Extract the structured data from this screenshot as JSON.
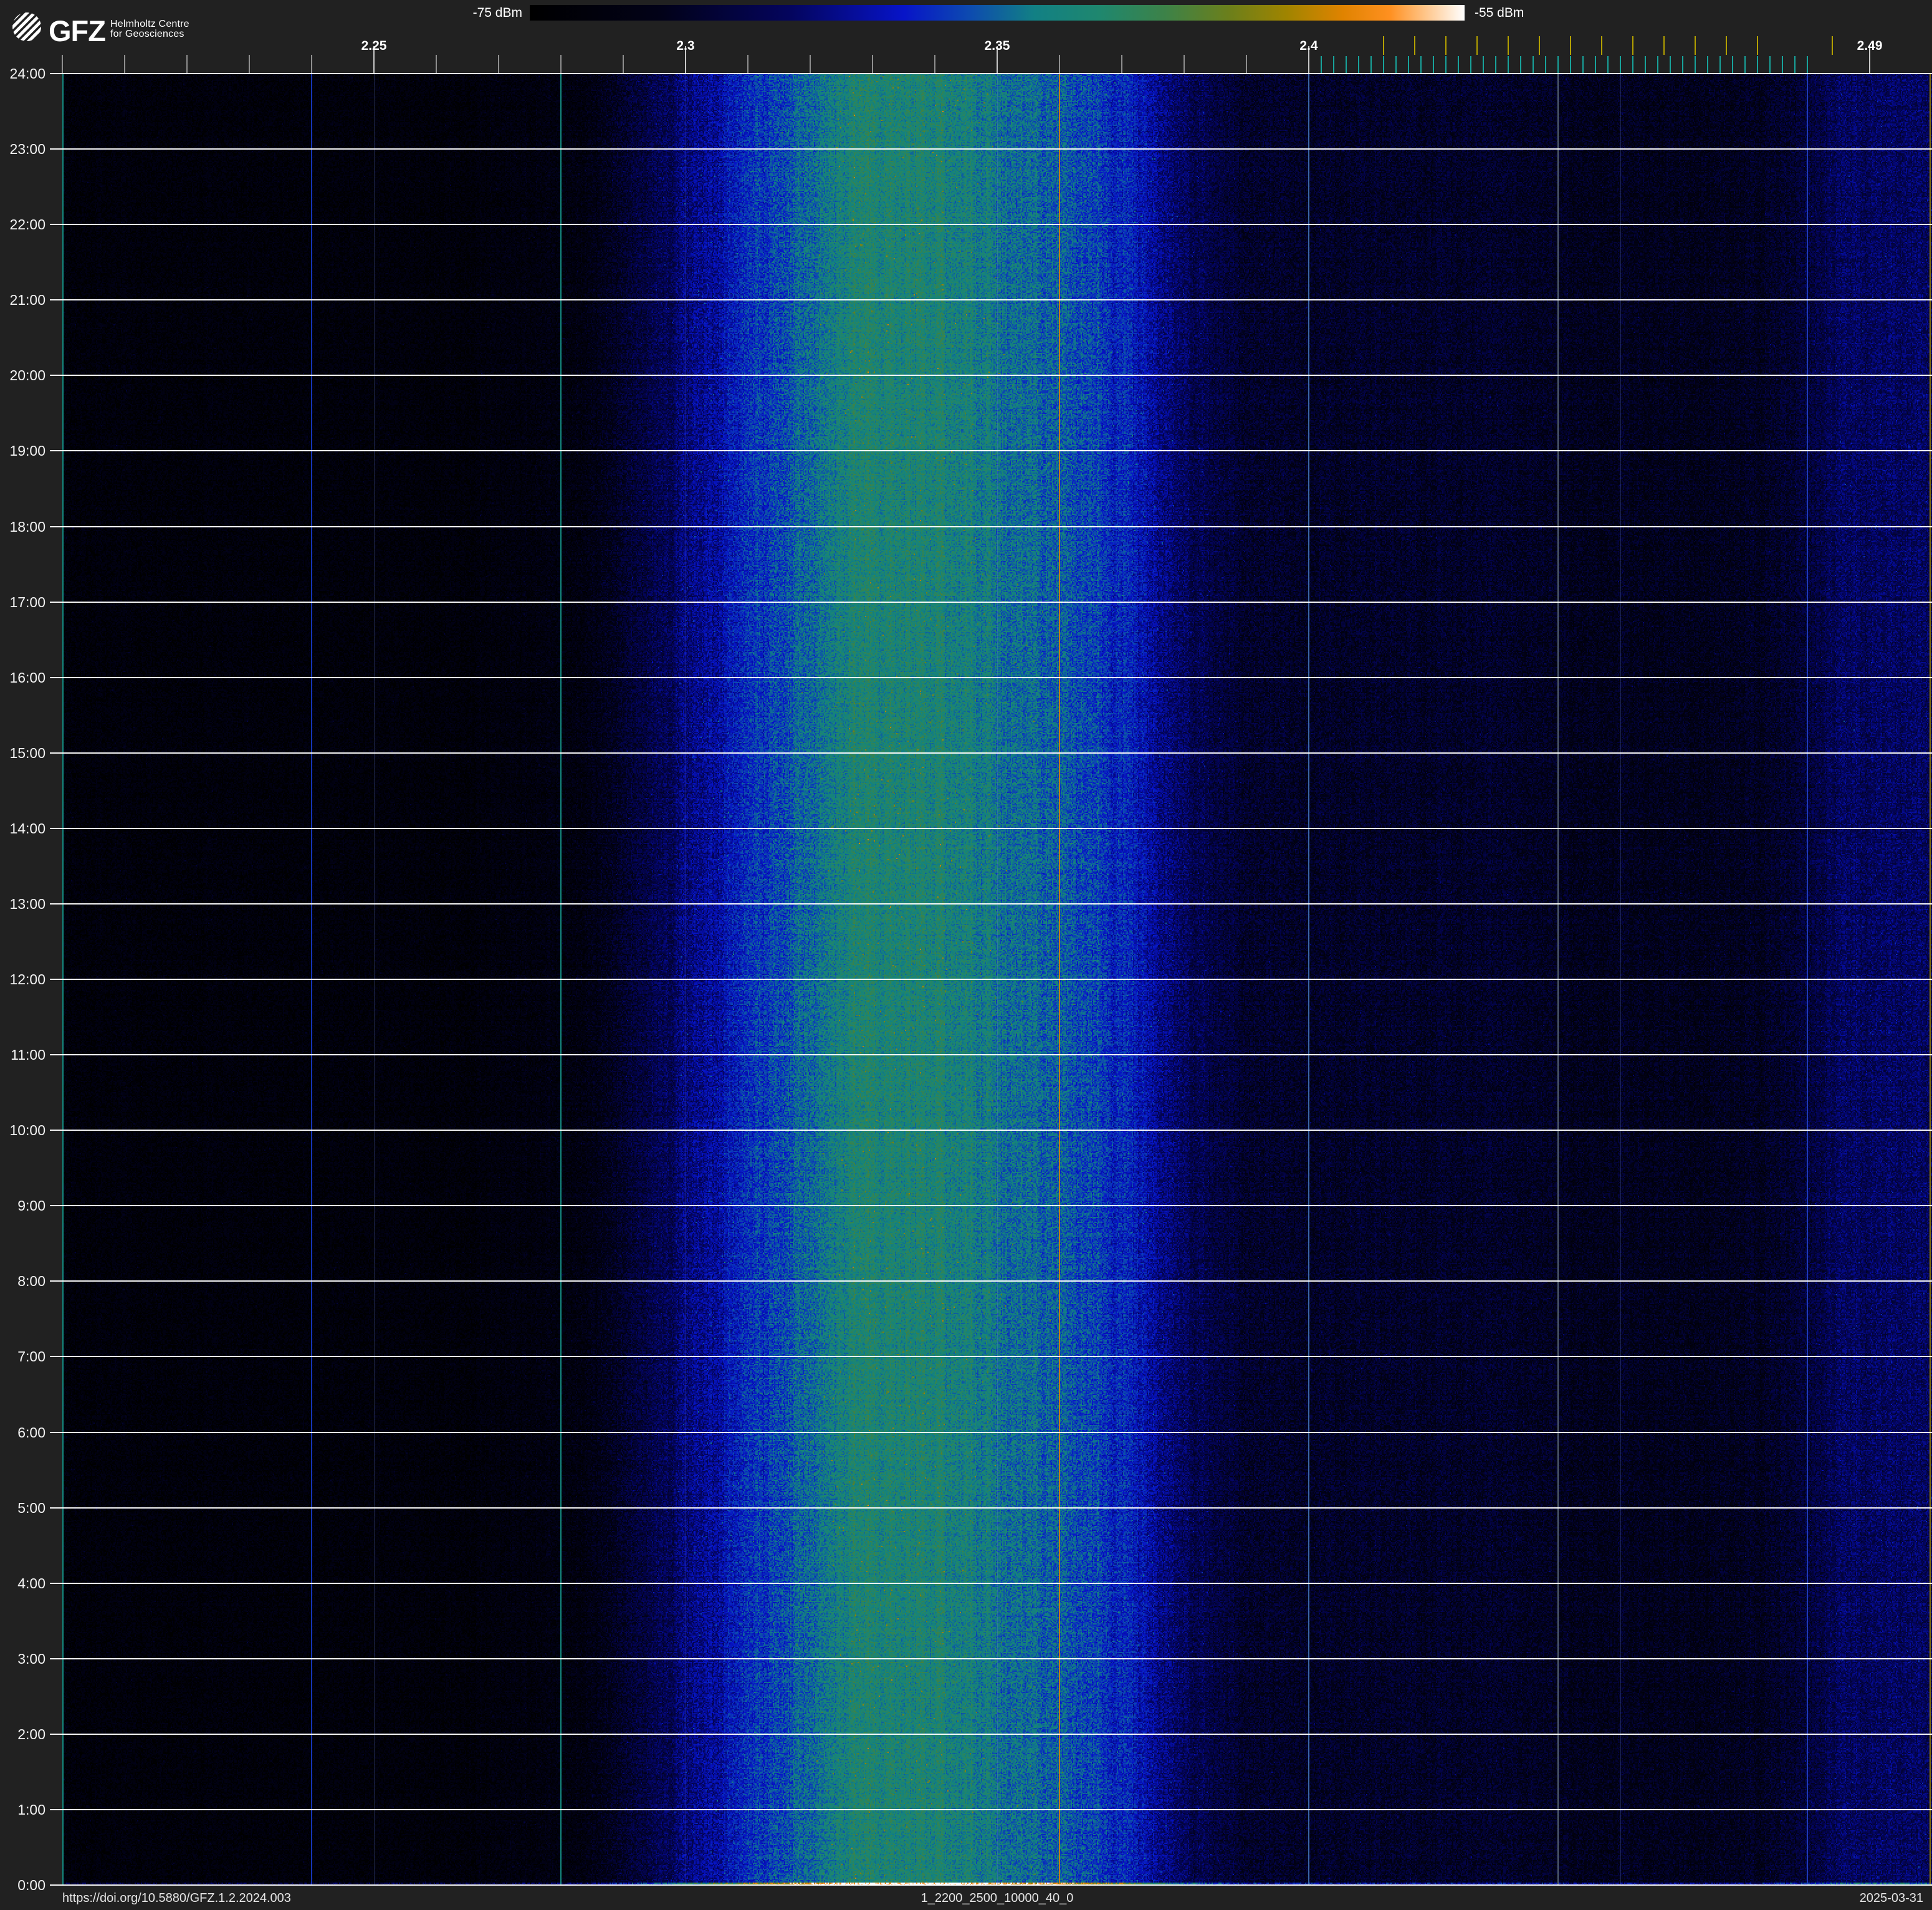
{
  "header": {
    "logo_acronym": "GFZ",
    "logo_line1": "Helmholtz Centre",
    "logo_line2": "for Geosciences"
  },
  "colorbar": {
    "min_label": "-75 dBm",
    "max_label": "-55 dBm",
    "stops": [
      {
        "t": 0.0,
        "c": "#000000"
      },
      {
        "t": 0.14,
        "c": "#020218"
      },
      {
        "t": 0.28,
        "c": "#04055e"
      },
      {
        "t": 0.4,
        "c": "#0714c8"
      },
      {
        "t": 0.47,
        "c": "#0d4ab0"
      },
      {
        "t": 0.54,
        "c": "#128084"
      },
      {
        "t": 0.61,
        "c": "#1f876e"
      },
      {
        "t": 0.68,
        "c": "#3d8248"
      },
      {
        "t": 0.75,
        "c": "#6d7f1a"
      },
      {
        "t": 0.81,
        "c": "#a08400"
      },
      {
        "t": 0.87,
        "c": "#e08300"
      },
      {
        "t": 0.92,
        "c": "#ff9020"
      },
      {
        "t": 0.96,
        "c": "#ffc88f"
      },
      {
        "t": 1.0,
        "c": "#ffffff"
      }
    ]
  },
  "footer": {
    "doi": "https://doi.org/10.5880/GFZ.1.2.2024.003",
    "dataset_id": "1_2200_2500_10000_40_0",
    "date": "2025-03-31"
  },
  "chart_data": {
    "type": "heatmap",
    "description": "24-hour RF waterfall spectrogram, 2.2-2.5 GHz, power scale -75 dBm (black) to -55 dBm (white)",
    "power_range_dbm": [
      -75,
      -55
    ],
    "x_axis": {
      "unit": "GHz",
      "min": 2.2,
      "max": 2.5,
      "major_ticks": [
        {
          "value": 2.25,
          "label": "2.25"
        },
        {
          "value": 2.3,
          "label": "2.3"
        },
        {
          "value": 2.35,
          "label": "2.35"
        },
        {
          "value": 2.4,
          "label": "2.4"
        },
        {
          "value": 2.49,
          "label": "2.49"
        }
      ],
      "minor_tick_step": 0.01,
      "minor_tick_min": 2.2,
      "minor_tick_max": 2.4,
      "minor_tick_color": "#8f8f8f",
      "wifi_channel_ticks": [
        2.412,
        2.417,
        2.422,
        2.427,
        2.432,
        2.437,
        2.442,
        2.447,
        2.452,
        2.457,
        2.462,
        2.467,
        2.472,
        2.484
      ],
      "wifi_tick_color": "#b3a000",
      "ble_channel_ticks": {
        "start": 2.402,
        "end": 2.48,
        "step": 0.002
      },
      "ble_tick_color": "#18a39b"
    },
    "y_axis": {
      "unit": "time of day",
      "hours": 24,
      "labels": [
        "24:00",
        "23:00",
        "22:00",
        "21:00",
        "20:00",
        "19:00",
        "18:00",
        "17:00",
        "16:00",
        "15:00",
        "14:00",
        "13:00",
        "12:00",
        "11:00",
        "10:00",
        "9:00",
        "8:00",
        "7:00",
        "6:00",
        "5:00",
        "4:00",
        "3:00",
        "2:00",
        "1:00",
        "0:00"
      ]
    },
    "intensity_profile": [
      [
        2.2,
        0.06
      ],
      [
        2.262,
        0.06
      ],
      [
        2.284,
        0.1
      ],
      [
        2.3,
        0.3
      ],
      [
        2.31,
        0.42
      ],
      [
        2.32,
        0.52
      ],
      [
        2.327,
        0.59
      ],
      [
        2.341,
        0.6
      ],
      [
        2.35,
        0.54
      ],
      [
        2.36,
        0.5
      ],
      [
        2.37,
        0.42
      ],
      [
        2.38,
        0.27
      ],
      [
        2.39,
        0.18
      ],
      [
        2.4,
        0.17
      ],
      [
        2.432,
        0.17
      ],
      [
        2.446,
        0.14
      ],
      [
        2.468,
        0.14
      ],
      [
        2.478,
        0.19
      ],
      [
        2.486,
        0.27
      ],
      [
        2.5,
        0.27
      ]
    ],
    "marker_lines": [
      {
        "freq_ghz": 2.2,
        "color": "#17968a"
      },
      {
        "freq_ghz": 2.24,
        "color": "#1738c4"
      },
      {
        "freq_ghz": 2.28,
        "color": "#17968a"
      },
      {
        "freq_ghz": 2.36,
        "color": "#cf7d16"
      },
      {
        "freq_ghz": 2.4,
        "color": "#3f6fb0"
      },
      {
        "freq_ghz": 2.44,
        "color": "#5a6878"
      },
      {
        "freq_ghz": 2.48,
        "color": "#1f3fc0"
      },
      {
        "freq_ghz": 2.4997,
        "color": "#8f7d08"
      }
    ],
    "grid_lines_ghz": [
      2.25,
      2.3,
      2.35,
      2.45
    ],
    "hour_line_color": "#ffffff",
    "plot_bg": "#010109"
  }
}
